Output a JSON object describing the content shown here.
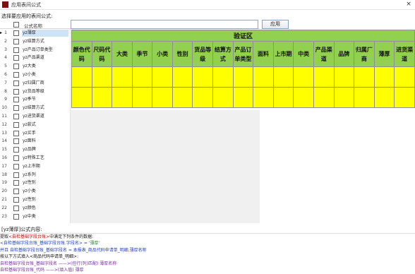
{
  "window": {
    "title": "应用表间公式",
    "close_label": "×"
  },
  "prompt": "选择要应用的表间公式:",
  "list_header": {
    "label": "公式名称"
  },
  "apply_button": "应用",
  "formula_rows": [
    {
      "num": "1",
      "label": "yz薄厚",
      "selected": true
    },
    {
      "num": "2",
      "label": "yz结算方式"
    },
    {
      "num": "3",
      "label": "yz产品订单类型"
    },
    {
      "num": "4",
      "label": "yz产品渠道"
    },
    {
      "num": "5",
      "label": "yz大类"
    },
    {
      "num": "6",
      "label": "yz小类"
    },
    {
      "num": "7",
      "label": "yz归属厂商"
    },
    {
      "num": "8",
      "label": "yz货品等级"
    },
    {
      "num": "9",
      "label": "yz季节"
    },
    {
      "num": "10",
      "label": "yz结算方式"
    },
    {
      "num": "11",
      "label": "yz进货渠道"
    },
    {
      "num": "12",
      "label": "yz款式"
    },
    {
      "num": "13",
      "label": "yz买手"
    },
    {
      "num": "14",
      "label": "yz面料"
    },
    {
      "num": "15",
      "label": "yz品牌"
    },
    {
      "num": "16",
      "label": "yz特殊工艺"
    },
    {
      "num": "17",
      "label": "yz上市期"
    },
    {
      "num": "18",
      "label": "yz系列"
    },
    {
      "num": "19",
      "label": "yz性别"
    },
    {
      "num": "20",
      "label": "yz小类"
    },
    {
      "num": "21",
      "label": "yz性别"
    },
    {
      "num": "22",
      "label": "yz颜色"
    },
    {
      "num": "23",
      "label": "yz中类"
    }
  ],
  "validation_table": {
    "title": "验证区",
    "headers": [
      "颜色代码",
      "尺码代码",
      "大类",
      "季节",
      "小类",
      "性别",
      "货品等级",
      "结算方式",
      "产品订单类型",
      "面料",
      "上市期",
      "中类",
      "产品渠道",
      "品牌",
      "归属厂商",
      "薄厚",
      "进货渠道"
    ],
    "fill_rows": 2
  },
  "detail": {
    "label": "[yz薄厚]公式内容:",
    "lines": [
      [
        {
          "t": "提取",
          "c": "black"
        },
        {
          "t": "<自检基础字段台账>",
          "c": "red"
        },
        {
          "t": "中满足下列条件的数据:",
          "c": "black"
        }
      ],
      [
        {
          "t": "   <自检基础字段台账_基础字段台账.字段名> = ",
          "c": "blue"
        },
        {
          "t": "'薄厚'",
          "c": "green"
        }
      ],
      [
        {
          "t": "         并且 自检基础字段台账_基础字段名 = 本报表_商品代码申请单_明细.薄厚名称",
          "c": "blue"
        }
      ],
      [
        {
          "t": "按以下方式填入<商品代码申请单_明细>:",
          "c": "black"
        }
      ],
      [
        {
          "t": "自检基础字段台账_基础字段名     ——>(任行(列)匹配)   薄厚名称",
          "c": "purple"
        }
      ],
      [
        {
          "t": "自检基础字段台账_代码     ——>(填入值)   薄厚",
          "c": "purple"
        }
      ]
    ]
  }
}
